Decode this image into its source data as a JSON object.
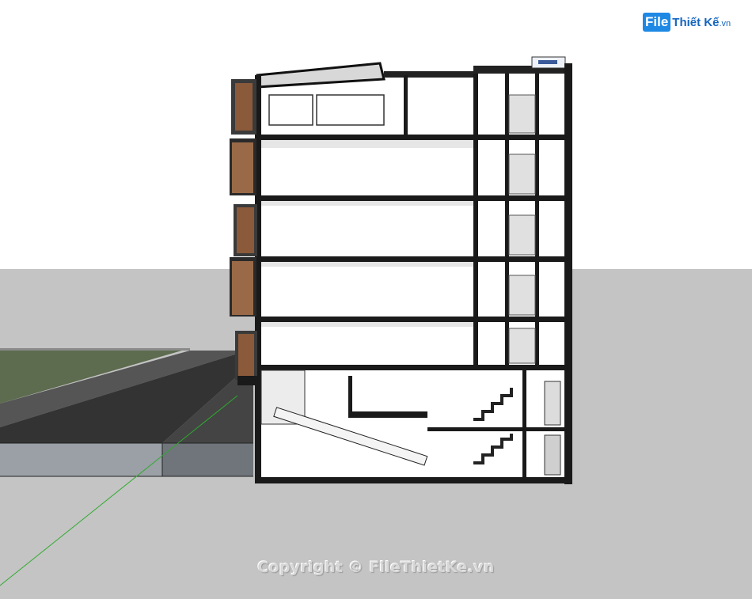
{
  "logo": {
    "box_text": "File",
    "rest_text": "Thiết Kế",
    "tld_text": ".vn"
  },
  "watermark": {
    "text": "Copyright © FileThietKe.vn"
  },
  "colors": {
    "sky": "#ffffff",
    "ground": "#c4c4c4",
    "grass": "#5d6b4f",
    "road": "#3a3a3a",
    "wall_cut": "#1a1a1a",
    "wood": "#8a5a3a",
    "axis_green": "#2eaa2e"
  },
  "icons": [
    "stair-icon",
    "railing-icon"
  ]
}
